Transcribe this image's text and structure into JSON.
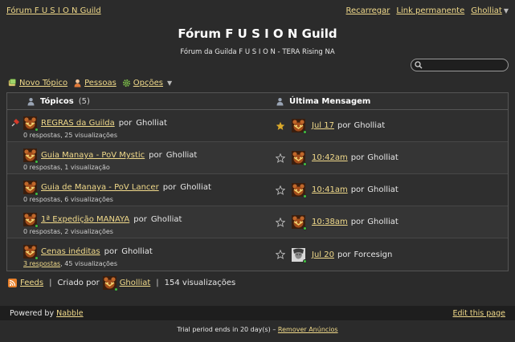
{
  "header": {
    "forum_link": "Fórum F U S I O N Guild",
    "reload": "Recarregar",
    "permalink": "Link permanente",
    "user": "Gholliat"
  },
  "title": "Fórum F U S I O N Guild",
  "subtitle": "Fórum da Guilda F U S I O N - TERA Rising NA",
  "search": {
    "placeholder": ""
  },
  "toolbar": {
    "new_topic": "Novo Tópico",
    "people": "Pessoas",
    "options": "Opções"
  },
  "table": {
    "col_topics": "Tópicos",
    "topic_count": "(5)",
    "col_last": "Última Mensagem",
    "rows": [
      {
        "title": "REGRAS da Guilda",
        "by": "por",
        "author": "Gholliat",
        "replies": "0 respostas",
        "views": ", 25 visualizações",
        "last_time": "Jul 17",
        "last_by": "por",
        "last_author": "Gholliat",
        "starred": true,
        "pinned": true,
        "last_avatar": "bear"
      },
      {
        "title": "Guia Manaya - PoV Mystic",
        "by": "por",
        "author": "Gholliat",
        "replies": "0 respostas",
        "views": ", 1 visualização",
        "last_time": "10:42am",
        "last_by": "por",
        "last_author": "Gholliat",
        "starred": false,
        "pinned": false,
        "last_avatar": "bear"
      },
      {
        "title": "Guia de Manaya - PoV Lancer",
        "by": "por",
        "author": "Gholliat",
        "replies": "0 respostas",
        "views": ", 6 visualizações",
        "last_time": "10:41am",
        "last_by": "por",
        "last_author": "Gholliat",
        "starred": false,
        "pinned": false,
        "last_avatar": "bear"
      },
      {
        "title": "1ª Expedição MANAYA",
        "by": "por",
        "author": "Gholliat",
        "replies": "0 respostas",
        "views": ", 2 visualizações",
        "last_time": "10:38am",
        "last_by": "por",
        "last_author": "Gholliat",
        "starred": false,
        "pinned": false,
        "last_avatar": "bear"
      },
      {
        "title": "Cenas inéditas",
        "by": "por",
        "author": "Gholliat",
        "replies": "3 respostas",
        "views": ", 45 visualizações",
        "last_time": "Jul 20",
        "last_by": "por",
        "last_author": "Forcesign",
        "starred": false,
        "pinned": false,
        "last_avatar": "face",
        "replies_link": true
      }
    ]
  },
  "footer": {
    "feeds": "Feeds",
    "created_by": "Criado por",
    "creator": "Gholliat",
    "views": "154 visualizações"
  },
  "powered": {
    "label": "Powered by",
    "nabble": "Nabble",
    "edit": "Edit this page"
  },
  "trial": {
    "text": "Trial period ends in 20 day(s) –",
    "remove": "Remover Anúncios"
  },
  "colors": {
    "background": "#2b2b2b",
    "link": "#f0d98a",
    "online": "#3fbf3f",
    "star": "#d9a82a"
  }
}
